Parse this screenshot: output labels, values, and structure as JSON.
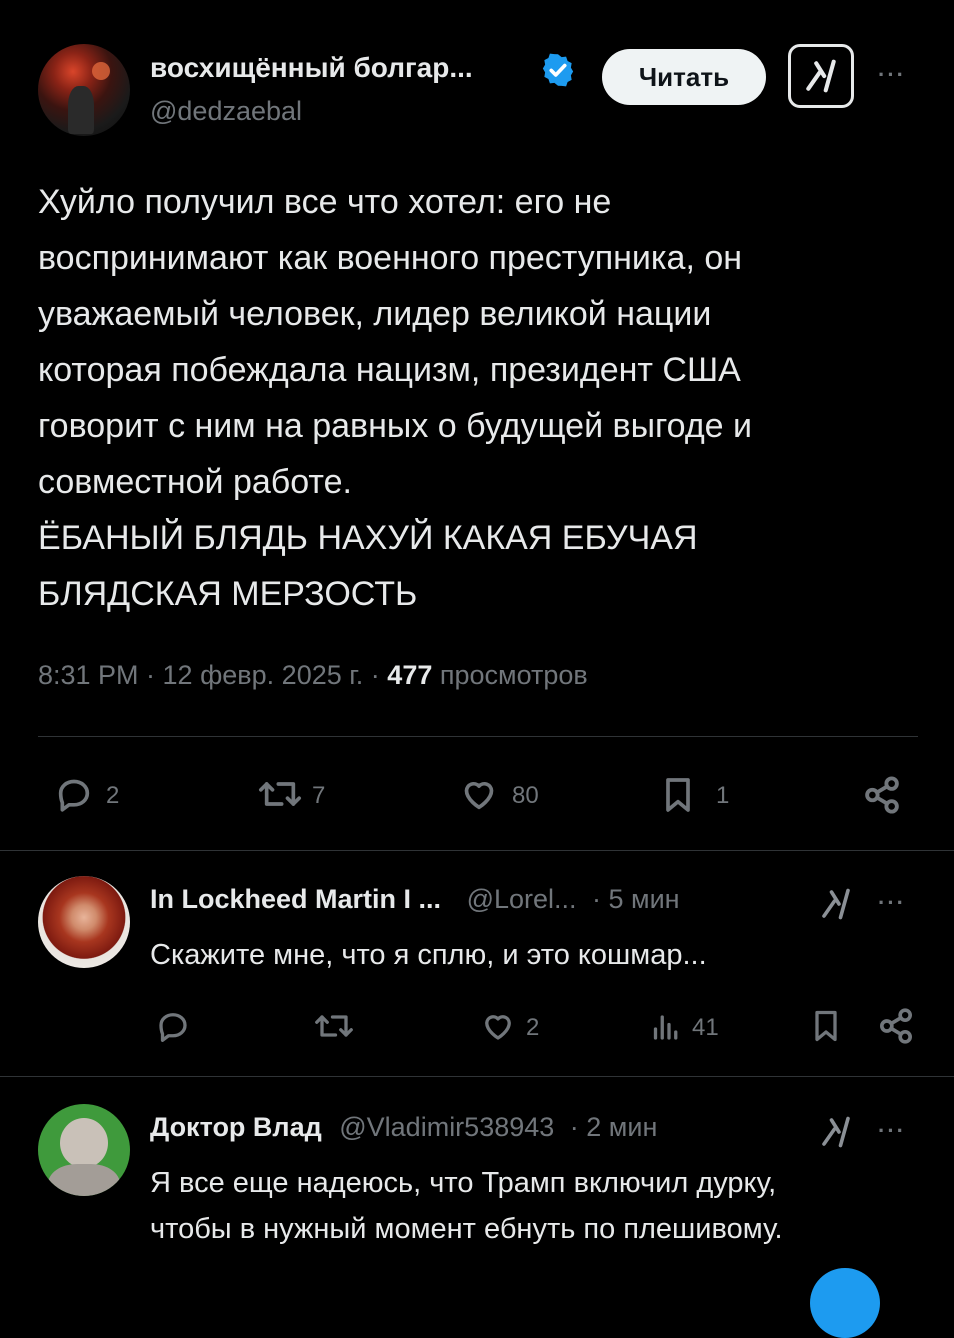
{
  "post": {
    "display_name": "восхищённый болгар...",
    "handle": "@dedzaebal",
    "follow_label": "Читать",
    "grok_label": "x/",
    "more_label": "···",
    "body_lines": [
      "Хуйло получил все что хотел: его не",
      "воспринимают как военного преступника, он",
      "уважаемый человек, лидер великой нации",
      "которая побеждала нацизм, президент США",
      "говорит с ним на равных о будущей выгоде и",
      "совместной работе.",
      "ЁБАНЫЙ БЛЯДЬ НАХУЙ КАКАЯ ЕБУЧАЯ",
      "БЛЯДСКАЯ МЕРЗОСТЬ"
    ],
    "timestamp": "8:31 PM · 12 февр. 2025 г. · ",
    "views_count": "477",
    "views_label": " просмотров",
    "stats": {
      "replies": "2",
      "reposts": "7",
      "likes": "80",
      "bookmarks": "1"
    }
  },
  "replies": [
    {
      "display_name": "In Lockheed Martin I ...",
      "handle": "@Lorel...",
      "time": "· 5 мин",
      "grok_label": "x/",
      "more_label": "···",
      "text_lines": [
        "Скажите мне, что я сплю, и это кошмар..."
      ],
      "stats": {
        "likes": "2",
        "views": "41"
      }
    },
    {
      "display_name": "Доктор Влад",
      "handle": "@Vladimir538943",
      "time": "· 2 мин",
      "grok_label": "x/",
      "more_label": "···",
      "text_lines": [
        "Я все еще надеюсь, что Трамп включил дурку,",
        "чтобы в нужный момент ебнуть по плешивому."
      ]
    }
  ],
  "colors": {
    "background": "#000000",
    "text": "#e7e9ea",
    "muted": "#71767b",
    "verified": "#1d9bf0",
    "divider": "#2f3336"
  }
}
